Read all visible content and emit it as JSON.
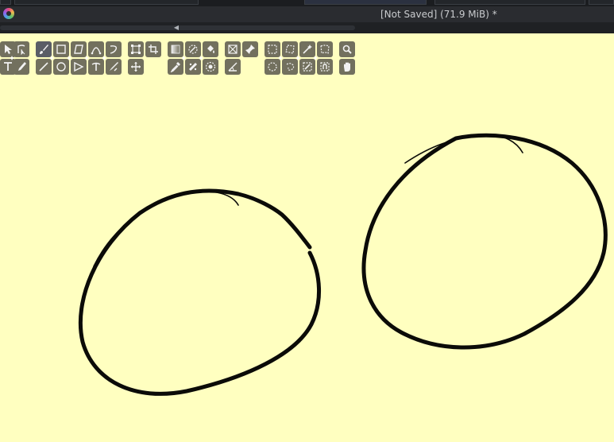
{
  "window": {
    "doc_title": "[Not Saved]  (71.9 MiB) *"
  },
  "toolbox": {
    "row1": [
      {
        "icon": "pointer-icon"
      },
      {
        "icon": "shape-select-icon"
      },
      {
        "icon": "brush-icon"
      },
      {
        "icon": "rectangle-icon"
      },
      {
        "icon": "polygon-icon"
      },
      {
        "icon": "bezier-icon"
      },
      {
        "icon": "freehand-path-icon"
      },
      {
        "icon": "transform-icon"
      },
      {
        "icon": "crop-icon"
      },
      {
        "icon": "gradient-icon"
      },
      {
        "icon": "colorize-mask-icon"
      },
      {
        "icon": "fill-icon"
      },
      {
        "icon": "assistant-icon"
      },
      {
        "icon": "reference-pin-icon"
      },
      {
        "icon": "rect-select-icon"
      },
      {
        "icon": "polygon-select-icon"
      },
      {
        "icon": "magic-wand-icon"
      },
      {
        "icon": "bezier-select-icon"
      },
      {
        "icon": "zoom-icon"
      }
    ],
    "row2": [
      {
        "icon": "text-icon"
      },
      {
        "icon": "calligraphy-icon"
      },
      {
        "icon": "line-icon"
      },
      {
        "icon": "ellipse-icon"
      },
      {
        "icon": "polyline-icon"
      },
      {
        "icon": "dynamic-brush-icon"
      },
      {
        "icon": "multibrush-icon"
      },
      {
        "icon": "move-icon"
      },
      {
        "icon": "eyedropper-icon"
      },
      {
        "icon": "smart-patch-icon"
      },
      {
        "icon": "enclose-fill-icon"
      },
      {
        "icon": "measure-icon"
      },
      {
        "icon": "ellipse-select-icon"
      },
      {
        "icon": "freehand-select-icon"
      },
      {
        "icon": "similar-select-icon"
      },
      {
        "icon": "magnetic-select-icon"
      },
      {
        "icon": "pan-icon"
      }
    ]
  }
}
